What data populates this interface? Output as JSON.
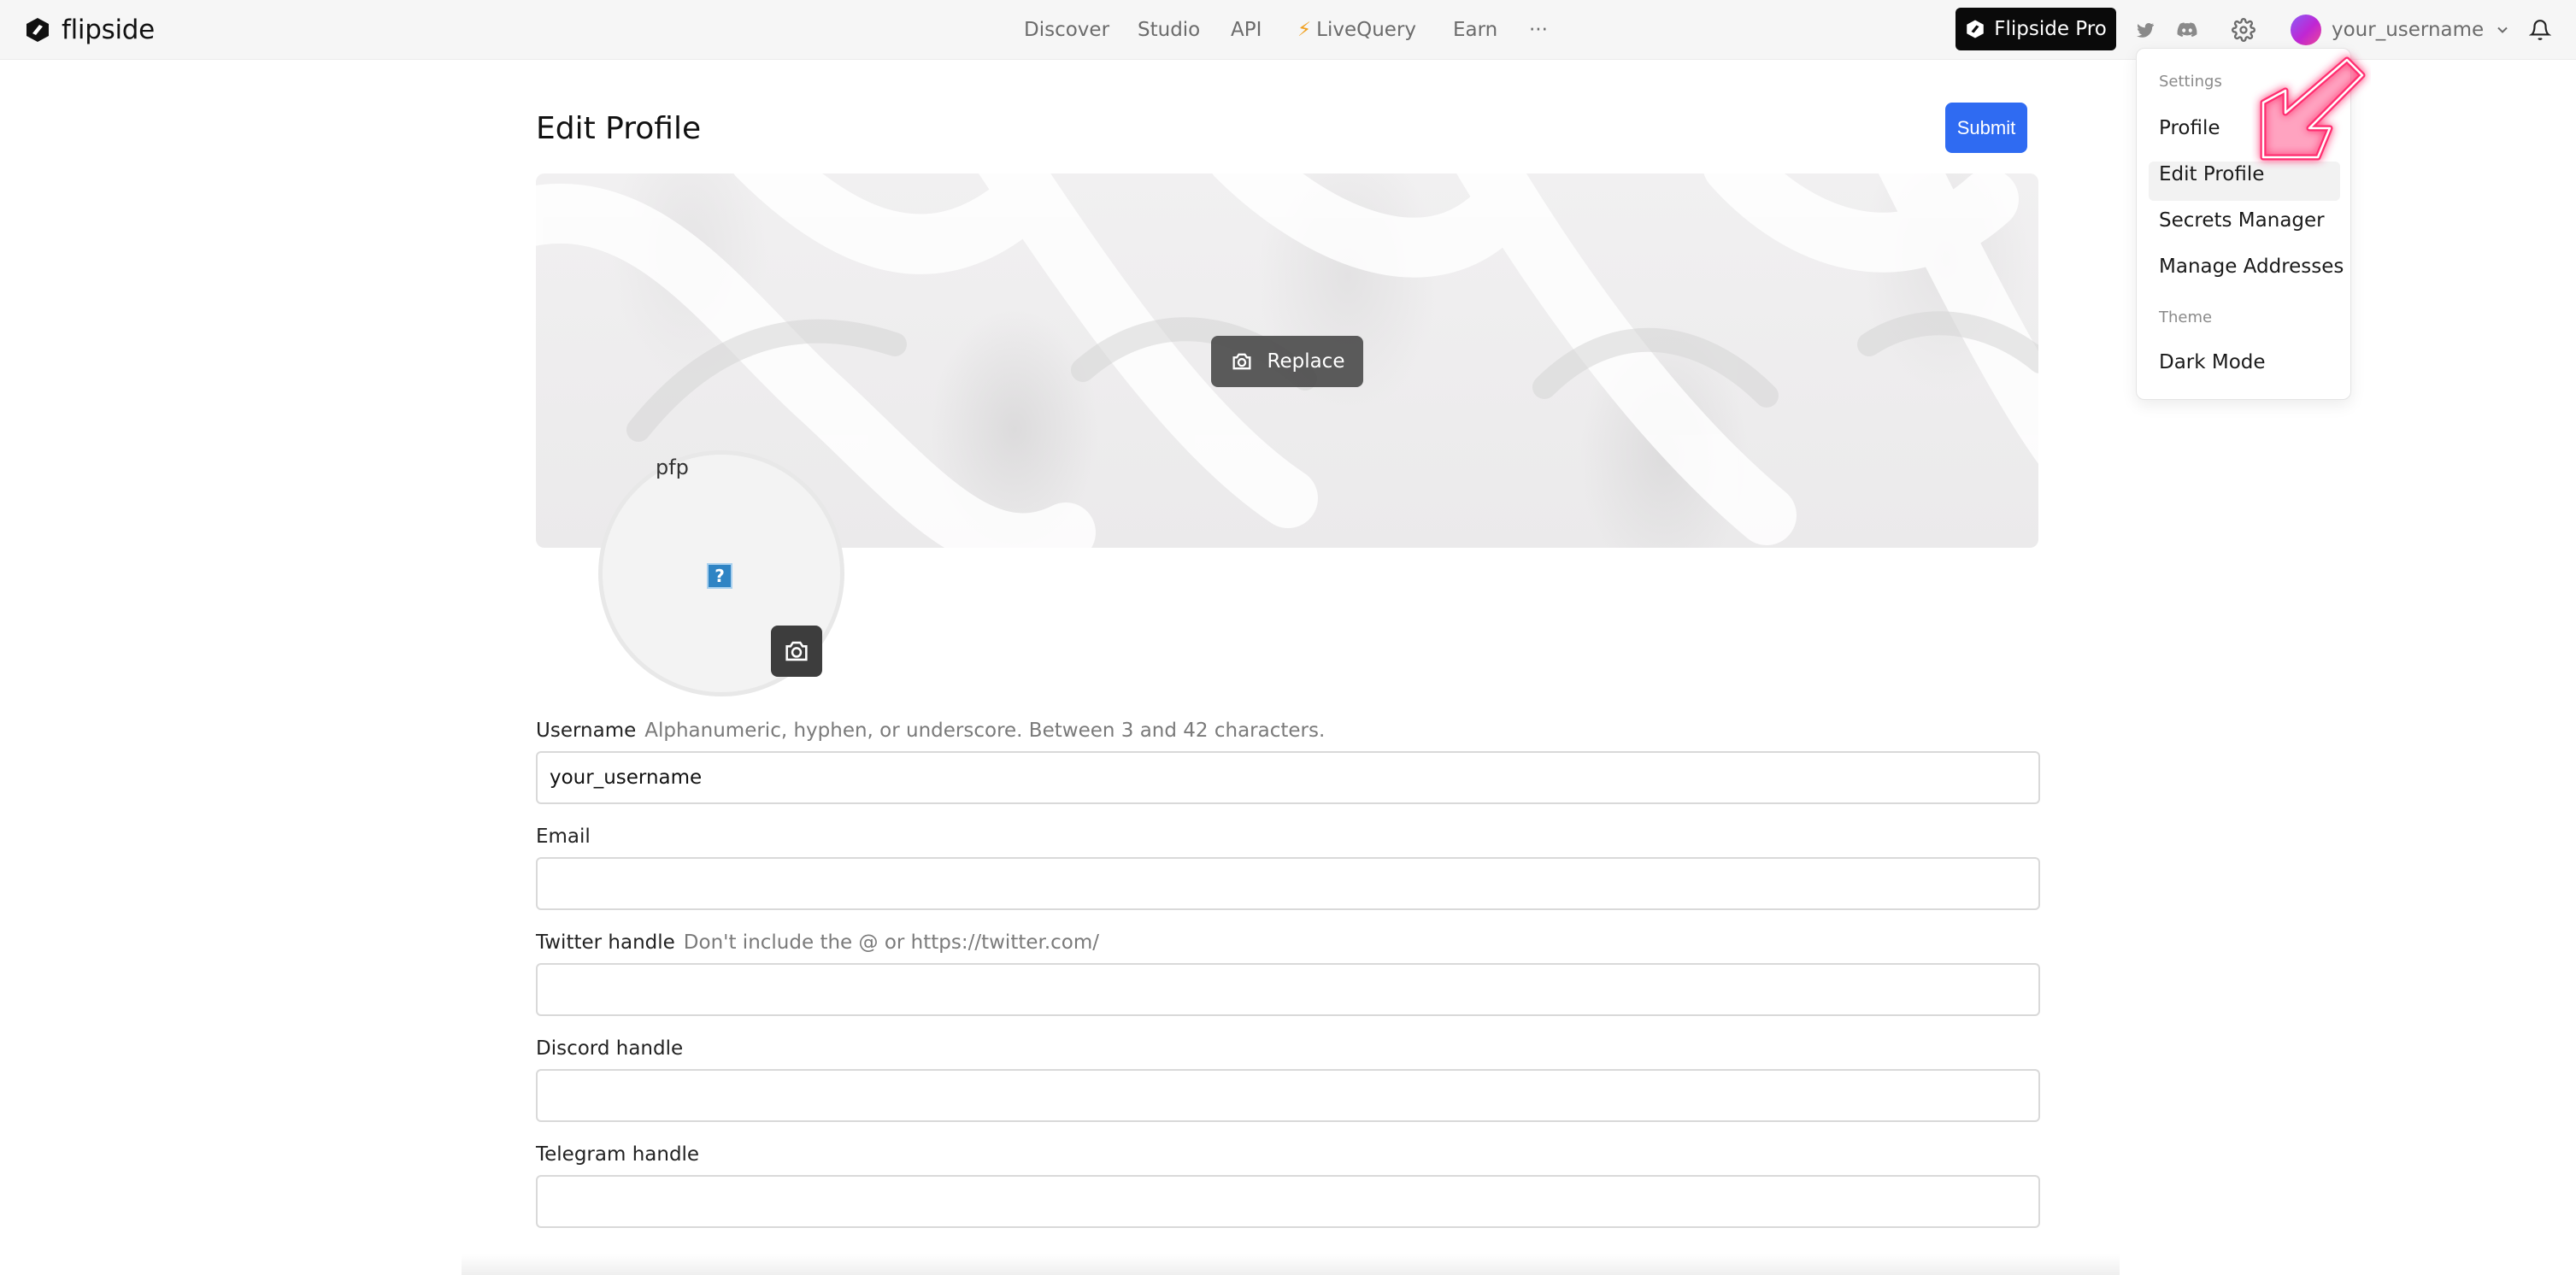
{
  "header": {
    "brand": "flipside",
    "nav": [
      {
        "label": "Discover"
      },
      {
        "label": "Studio"
      },
      {
        "label": "API"
      },
      {
        "label": "LiveQuery",
        "icon": "lightning-icon"
      },
      {
        "label": "Earn"
      },
      {
        "label": "···"
      }
    ],
    "pro_button": "Flipside Pro",
    "username": "your_username",
    "icons": [
      "twitter-icon",
      "discord-icon",
      "gear-icon",
      "chevron-down-icon",
      "bell-icon"
    ]
  },
  "page": {
    "title": "Edit Profile",
    "submit_label": "Submit",
    "replace_label": "Replace",
    "avatar_alt": "pfp"
  },
  "form": {
    "username": {
      "label": "Username",
      "hint": "Alphanumeric, hyphen, or underscore. Between 3 and 42 characters.",
      "value": "your_username"
    },
    "email": {
      "label": "Email",
      "value": ""
    },
    "twitter": {
      "label": "Twitter handle",
      "hint": "Don't include the @ or https://twitter.com/",
      "value": ""
    },
    "discord": {
      "label": "Discord handle",
      "value": ""
    },
    "telegram": {
      "label": "Telegram handle",
      "value": ""
    }
  },
  "dropdown": {
    "settings_header": "Settings",
    "items": [
      {
        "label": "Profile"
      },
      {
        "label": "Edit Profile",
        "active": true
      },
      {
        "label": "Secrets Manager"
      },
      {
        "label": "Manage Addresses"
      }
    ],
    "theme_header": "Theme",
    "theme_item": "Dark Mode"
  },
  "colors": {
    "accent": "#2f6bf2",
    "pro_button_bg": "#0a0a0a",
    "highlight_arrow": "#ff2d6f"
  }
}
